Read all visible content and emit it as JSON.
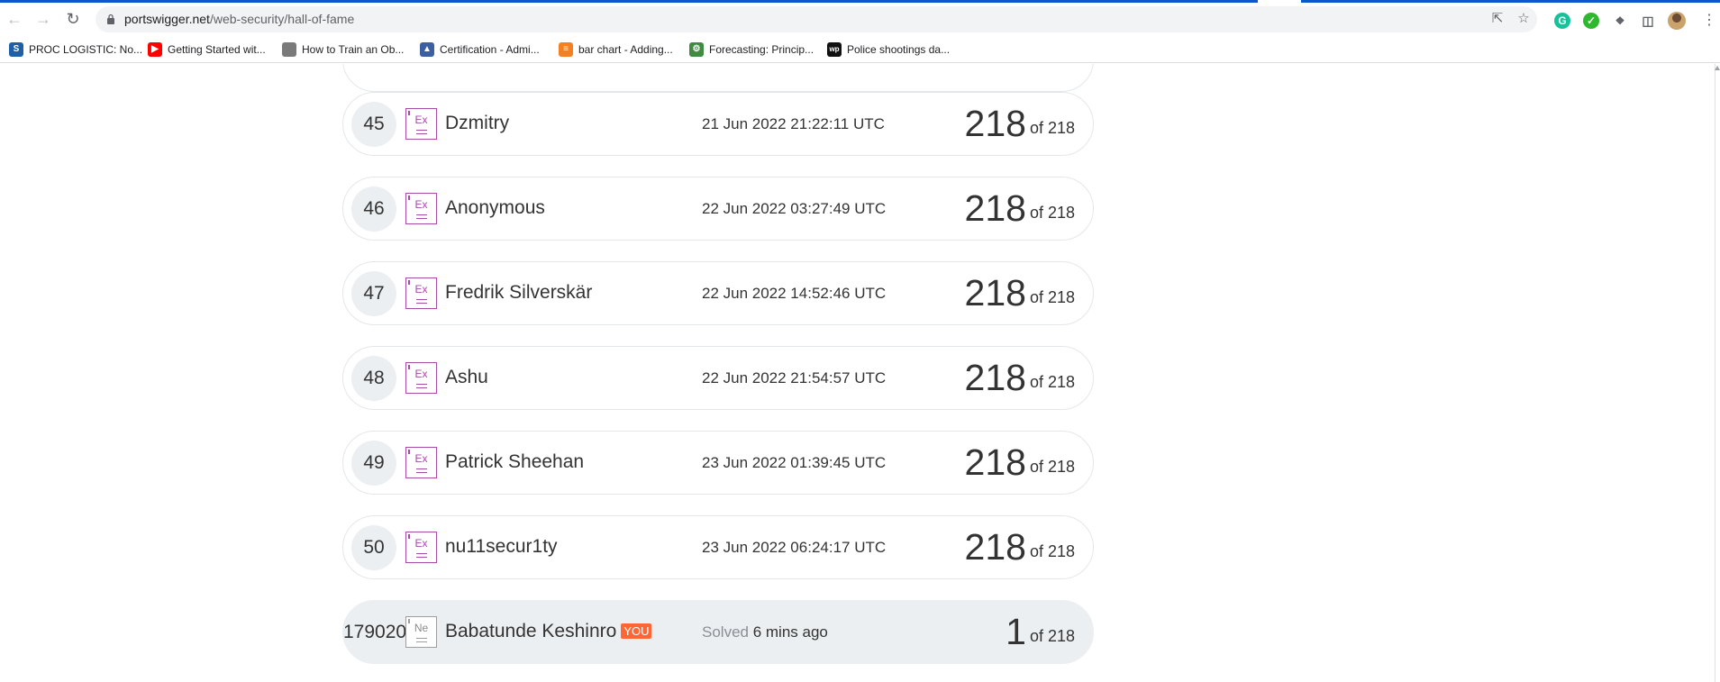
{
  "browser": {
    "url_host": "portswigger.net",
    "url_path": "/web-security/hall-of-fame",
    "nav_icons": [
      "back-arrow-icon",
      "forward-arrow-icon",
      "reload-icon"
    ],
    "omnibox_icons": [
      "share-icon",
      "star-icon"
    ],
    "extensions": [
      "grammarly-icon",
      "checkmark-extension-icon",
      "puzzle-icon",
      "sidebar-icon"
    ]
  },
  "bookmarks": [
    {
      "label": "PROC LOGISTIC: No...",
      "icon": "sas-icon",
      "color": "#1f5fa8"
    },
    {
      "label": "Getting Started wit...",
      "icon": "youtube-icon",
      "color": "#ff0000"
    },
    {
      "label": "How to Train an Ob...",
      "icon": "image-icon",
      "color": "#7a7a7a"
    },
    {
      "label": "Certification - Admi...",
      "icon": "certification-icon",
      "color": "#3b5fa0"
    },
    {
      "label": "bar chart - Adding...",
      "icon": "stackoverflow-icon",
      "color": "#f48024"
    },
    {
      "label": "Forecasting: Princip...",
      "icon": "forecasting-icon",
      "color": "#3f8b3f"
    },
    {
      "label": "Police shootings da...",
      "icon": "washington-post-icon",
      "color": "#111111"
    }
  ],
  "rows": [
    {
      "rank": "45",
      "level": "Ex",
      "name": "Dzmitry",
      "date": "21 Jun 2022 21:22:11 UTC",
      "solved": "218",
      "of": "of 218"
    },
    {
      "rank": "46",
      "level": "Ex",
      "name": "Anonymous",
      "date": "22 Jun 2022 03:27:49 UTC",
      "solved": "218",
      "of": "of 218"
    },
    {
      "rank": "47",
      "level": "Ex",
      "name": "Fredrik Silverskär",
      "date": "22 Jun 2022 14:52:46 UTC",
      "solved": "218",
      "of": "of 218"
    },
    {
      "rank": "48",
      "level": "Ex",
      "name": "Ashu",
      "date": "22 Jun 2022 21:54:57 UTC",
      "solved": "218",
      "of": "of 218"
    },
    {
      "rank": "49",
      "level": "Ex",
      "name": "Patrick Sheehan",
      "date": "23 Jun 2022 01:39:45 UTC",
      "solved": "218",
      "of": "of 218"
    },
    {
      "rank": "50",
      "level": "Ex",
      "name": "nu11secur1ty",
      "date": "23 Jun 2022 06:24:17 UTC",
      "solved": "218",
      "of": "of 218"
    }
  ],
  "you_row": {
    "rank": "179020",
    "level": "Ne",
    "name": "Babatunde Keshinro",
    "tag": "YOU",
    "solved_prefix": "Solved",
    "solved_ago": "6 mins ago",
    "solved": "1",
    "of": "of 218"
  },
  "colors": {
    "expert_badge": "#a64ca6",
    "you_tag": "#ff6633",
    "row_border": "#e4e7ea",
    "you_row_bg": "#eceff1"
  }
}
